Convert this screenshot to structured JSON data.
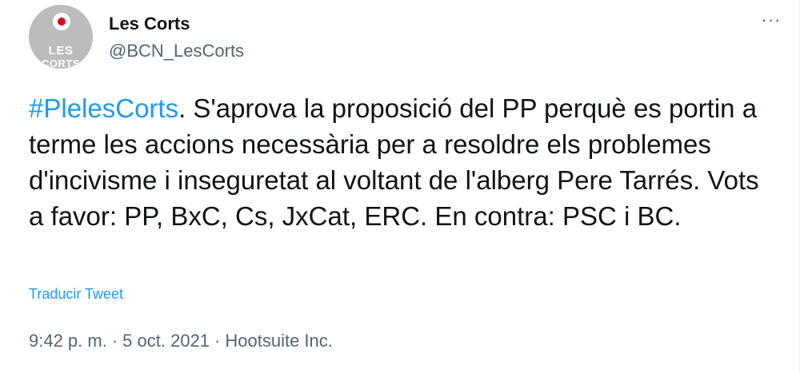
{
  "author": {
    "display_name": "Les Corts",
    "username": "@BCN_LesCorts",
    "avatar_line1": "LES",
    "avatar_line2": "CORTS"
  },
  "more_label": "···",
  "tweet": {
    "hashtag": "#PlelesCorts",
    "text": ". S'aprova la proposició del PP perquè es portin a terme les accions necessària per a resoldre els problemes d'incivisme i inseguretat al voltant de l'alberg Pere Tarrés. Vots a favor: PP, BxC, Cs, JxCat, ERC. En contra: PSC i BC."
  },
  "translate_label": "Traducir Tweet",
  "meta": {
    "time": "9:42 p. m.",
    "date": "5 oct. 2021",
    "source": "Hootsuite Inc.",
    "separator": "·"
  },
  "colors": {
    "accent": "#1d9bf0",
    "text": "#0f1419",
    "secondary": "#536471",
    "brand_red": "#e2001a"
  }
}
